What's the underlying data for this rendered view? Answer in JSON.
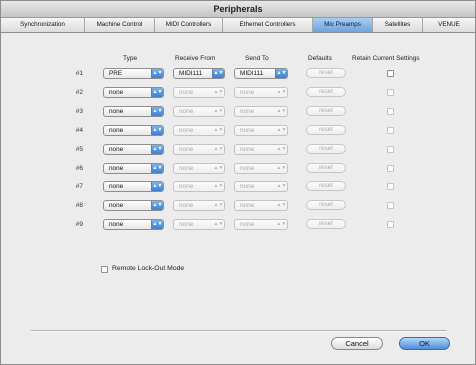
{
  "window": {
    "title": "Peripherals"
  },
  "tabs": [
    {
      "label": "Synchronization",
      "active": false
    },
    {
      "label": "Machine Control",
      "active": false
    },
    {
      "label": "MIDI Controllers",
      "active": false
    },
    {
      "label": "Ethernet Controllers",
      "active": false
    },
    {
      "label": "Mic Preamps",
      "active": true
    },
    {
      "label": "Satellites",
      "active": false
    },
    {
      "label": "VENUE",
      "active": false
    }
  ],
  "columns": {
    "type": "Type",
    "receive_from": "Receive From",
    "send_to": "Send To",
    "defaults": "Defaults",
    "retain": "Retain Current Settings"
  },
  "rows": [
    {
      "label": "#1",
      "type": "PRE",
      "receive": "MIDI111",
      "send": "MIDI111",
      "reset": "reset",
      "retain": false
    },
    {
      "label": "#2",
      "type": "none",
      "receive": "none",
      "send": "none",
      "reset": "reset",
      "retain": false
    },
    {
      "label": "#3",
      "type": "none",
      "receive": "none",
      "send": "none",
      "reset": "reset",
      "retain": false
    },
    {
      "label": "#4",
      "type": "none",
      "receive": "none",
      "send": "none",
      "reset": "reset",
      "retain": false
    },
    {
      "label": "#5",
      "type": "none",
      "receive": "none",
      "send": "none",
      "reset": "reset",
      "retain": false
    },
    {
      "label": "#6",
      "type": "none",
      "receive": "none",
      "send": "none",
      "reset": "reset",
      "retain": false
    },
    {
      "label": "#7",
      "type": "none",
      "receive": "none",
      "send": "none",
      "reset": "reset",
      "retain": false
    },
    {
      "label": "#8",
      "type": "none",
      "receive": "none",
      "send": "none",
      "reset": "reset",
      "retain": false
    },
    {
      "label": "#9",
      "type": "none",
      "receive": "none",
      "send": "none",
      "reset": "reset",
      "retain": false
    }
  ],
  "remote_lockout": {
    "label": "Remote Lock-Out Mode",
    "checked": false
  },
  "buttons": {
    "cancel": "Cancel",
    "ok": "OK"
  },
  "colors": {
    "accent_blue": "#4e8ed9",
    "active_tab": "#6ea3de"
  }
}
